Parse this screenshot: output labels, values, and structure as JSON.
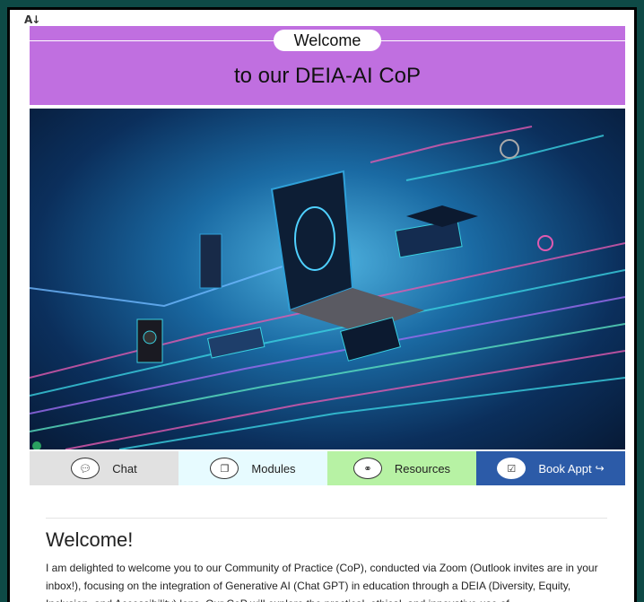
{
  "banner": {
    "pill_label": "Welcome",
    "title": "to our DEIA-AI CoP"
  },
  "nav": {
    "chat_label": "Chat",
    "modules_label": "Modules",
    "resources_label": "Resources",
    "book_label": "Book Appt"
  },
  "content": {
    "heading": "Welcome!",
    "paragraph": "I am delighted to welcome you to our Community of Practice (CoP), conducted via Zoom (Outlook invites are in your inbox!), focusing on the integration of Generative AI (Chat GPT) in education through a DEIA (Diversity, Equity, Inclusion, and Accessibility) lens. Our CoP will explore the practical, ethical, and innovative use of"
  },
  "colors": {
    "page_bg": "#0e4a46",
    "banner": "#c06fe0",
    "chat": "#e1e1e1",
    "modules": "#e7fbff",
    "resources": "#b7f2a4",
    "book": "#2c5ba8"
  }
}
